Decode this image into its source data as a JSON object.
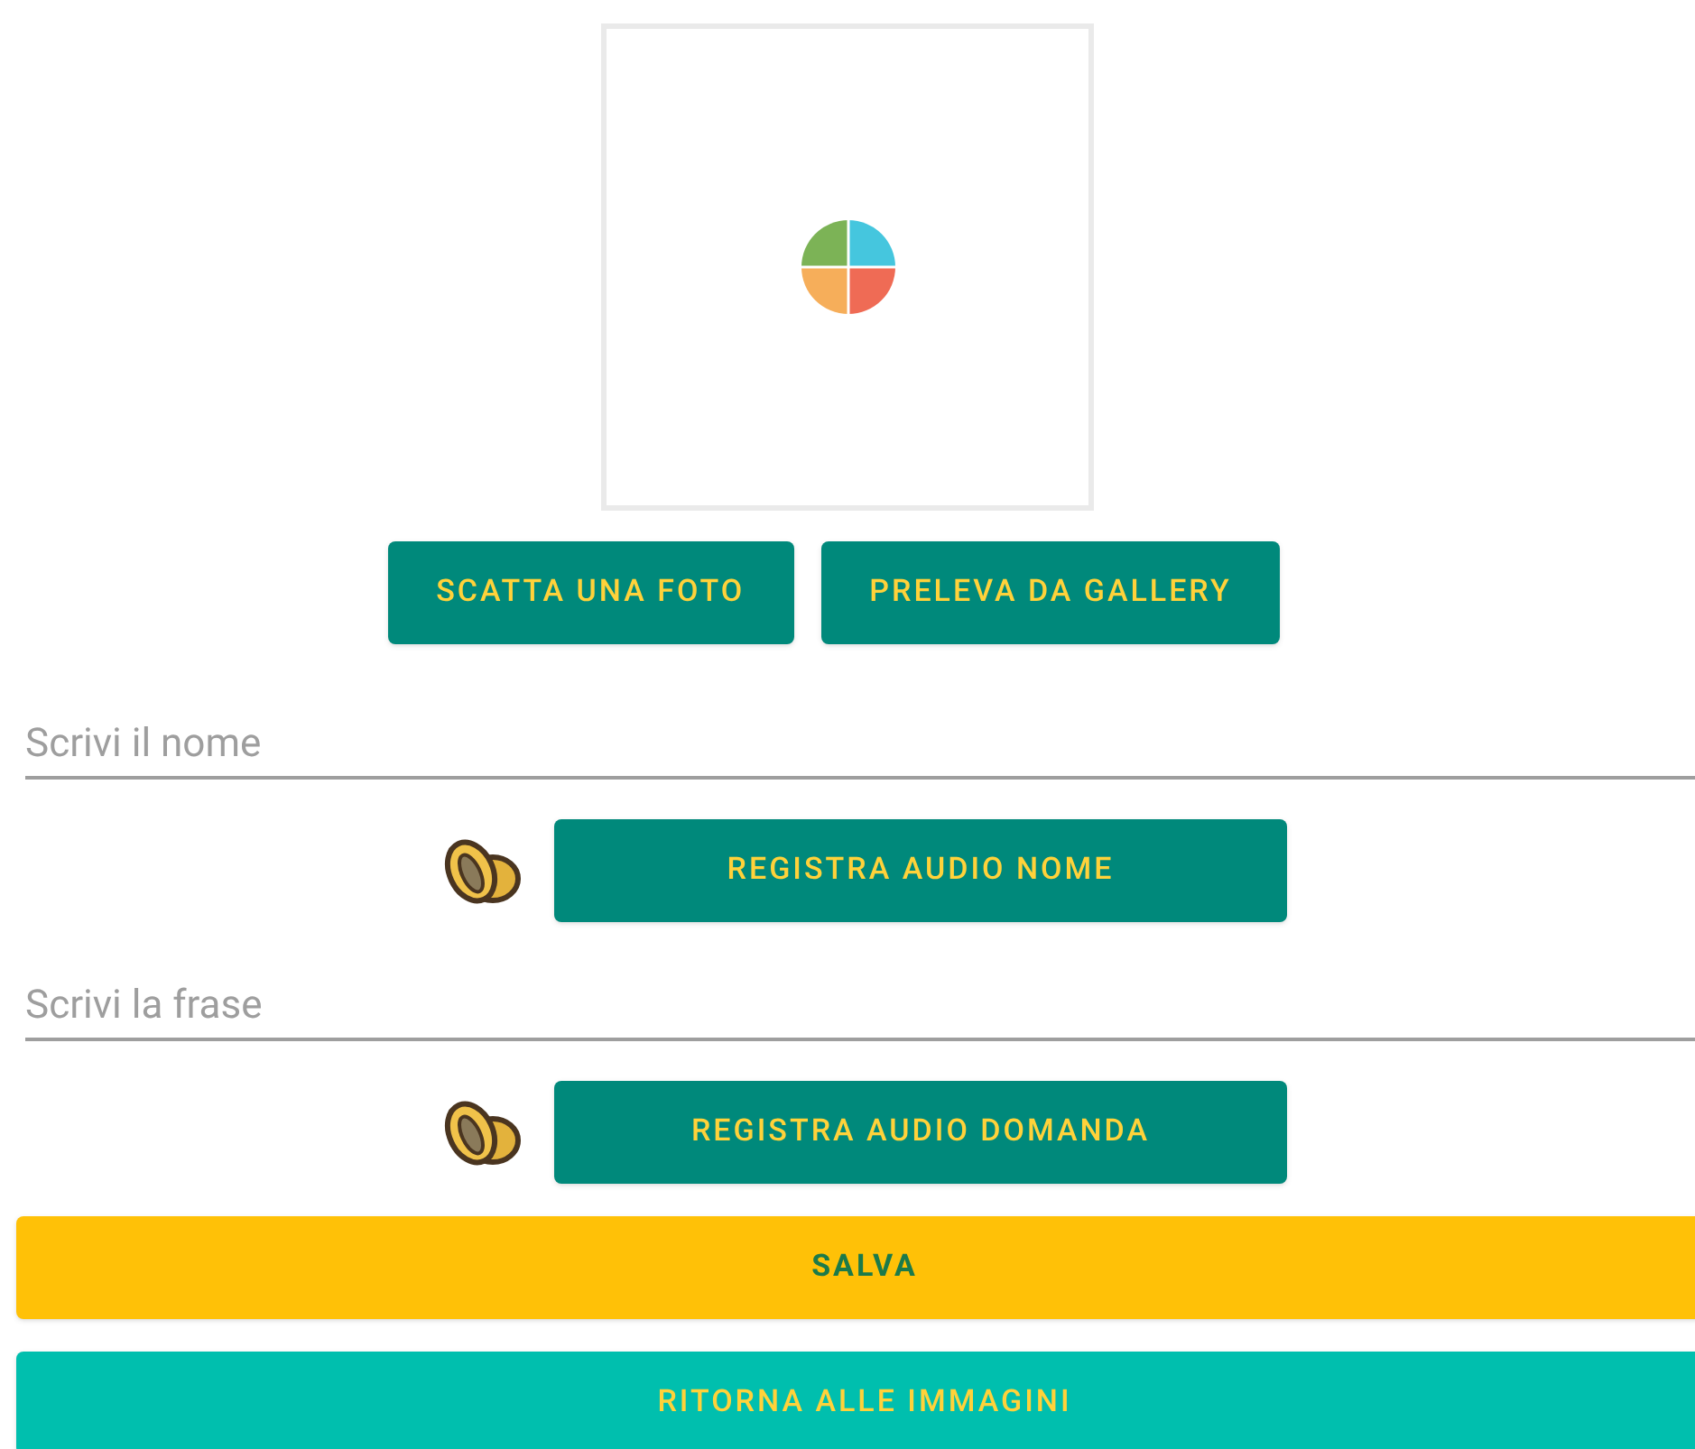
{
  "photo_buttons": [
    {
      "label": "SCATTA UNA FOTO"
    },
    {
      "label": "PRELEVA DA GALLERY"
    }
  ],
  "name_field": {
    "placeholder": "Scrivi il nome"
  },
  "name_audio_button": {
    "label": "REGISTRA AUDIO NOME"
  },
  "phrase_field": {
    "placeholder": "Scrivi la frase"
  },
  "question_audio_button": {
    "label": "REGISTRA AUDIO DOMANDA"
  },
  "save_button": {
    "label": "SALVA"
  },
  "back_button": {
    "label": "RITORNA ALLE IMMAGINI"
  }
}
